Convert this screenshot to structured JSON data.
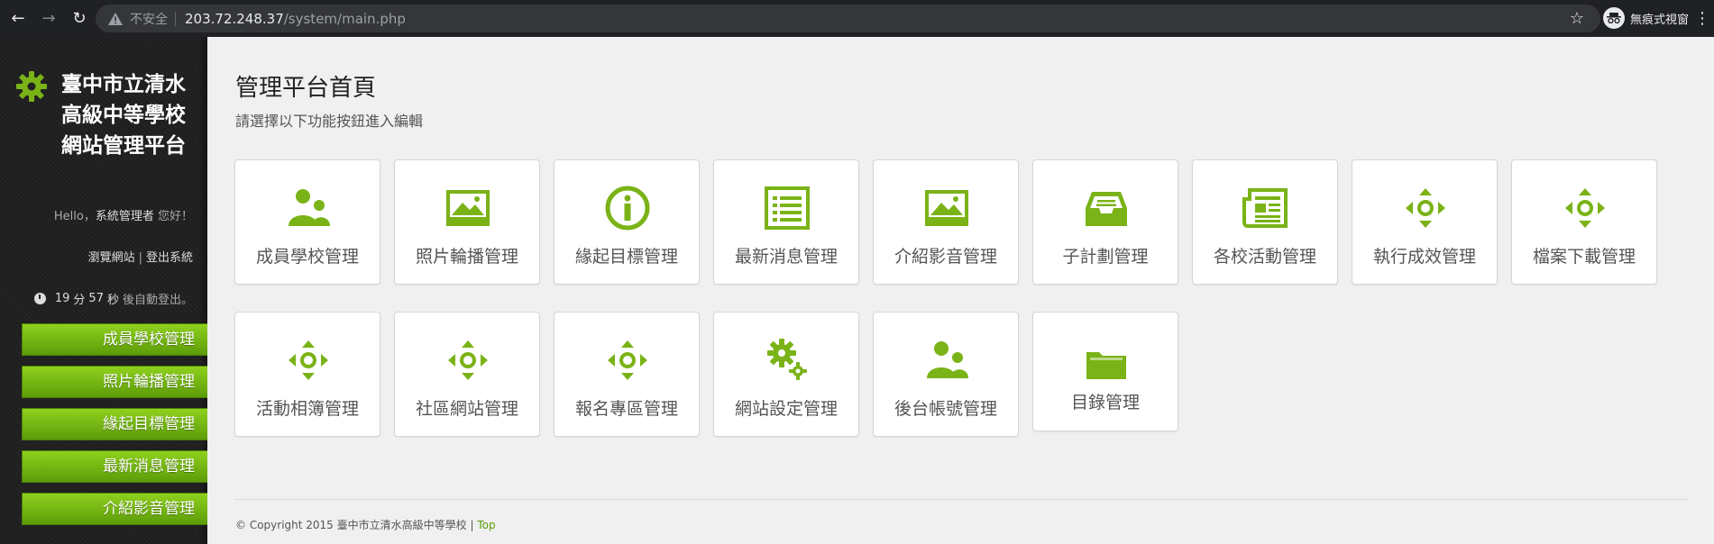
{
  "browser": {
    "insecure_label": "不安全",
    "url_host": "203.72.248.37",
    "url_path": "/system/main.php",
    "incognito_label": "無痕式視窗"
  },
  "sidebar": {
    "title_lines": [
      "臺中市立清水",
      "高級中等學校",
      "網站管理平台"
    ],
    "hello_prefix": "Hello，",
    "user_name": "系統管理者",
    "hello_suffix": "您好！",
    "browse_link": "瀏覽網站",
    "link_separator": "|",
    "logout_link": "登出系統",
    "timer_minutes": "19",
    "timer_unit_min": "分",
    "timer_seconds": "57",
    "timer_unit_sec": "秒",
    "timer_suffix": "後自動登出。",
    "menu": [
      "成員學校管理",
      "照片輪播管理",
      "緣起目標管理",
      "最新消息管理",
      "介紹影音管理"
    ]
  },
  "main": {
    "title": "管理平台首頁",
    "subtitle": "請選擇以下功能按鈕進入編輯",
    "tiles": [
      {
        "label": "成員學校管理",
        "icon": "users-icon"
      },
      {
        "label": "照片輪播管理",
        "icon": "picture-icon"
      },
      {
        "label": "緣起目標管理",
        "icon": "info-icon"
      },
      {
        "label": "最新消息管理",
        "icon": "list-icon"
      },
      {
        "label": "介紹影音管理",
        "icon": "picture-icon"
      },
      {
        "label": "子計劃管理",
        "icon": "inbox-icon"
      },
      {
        "label": "各校活動管理",
        "icon": "newspaper-icon"
      },
      {
        "label": "執行成效管理",
        "icon": "move-icon"
      },
      {
        "label": "檔案下載管理",
        "icon": "move-icon"
      },
      {
        "label": "活動相簿管理",
        "icon": "move-icon"
      },
      {
        "label": "社區網站管理",
        "icon": "move-icon"
      },
      {
        "label": "報名專區管理",
        "icon": "move-icon"
      },
      {
        "label": "網站設定管理",
        "icon": "gears-icon"
      },
      {
        "label": "後台帳號管理",
        "icon": "users-icon"
      },
      {
        "label": "目錄管理",
        "icon": "folder-icon"
      }
    ],
    "footer_text": "© Copyright 2015 臺中市立清水高級中等學校",
    "footer_sep": "|",
    "footer_top": "Top"
  },
  "colors": {
    "accent": "#7ab317",
    "accent_dark": "#5c9c08",
    "sidebar_bg": "#222222"
  }
}
